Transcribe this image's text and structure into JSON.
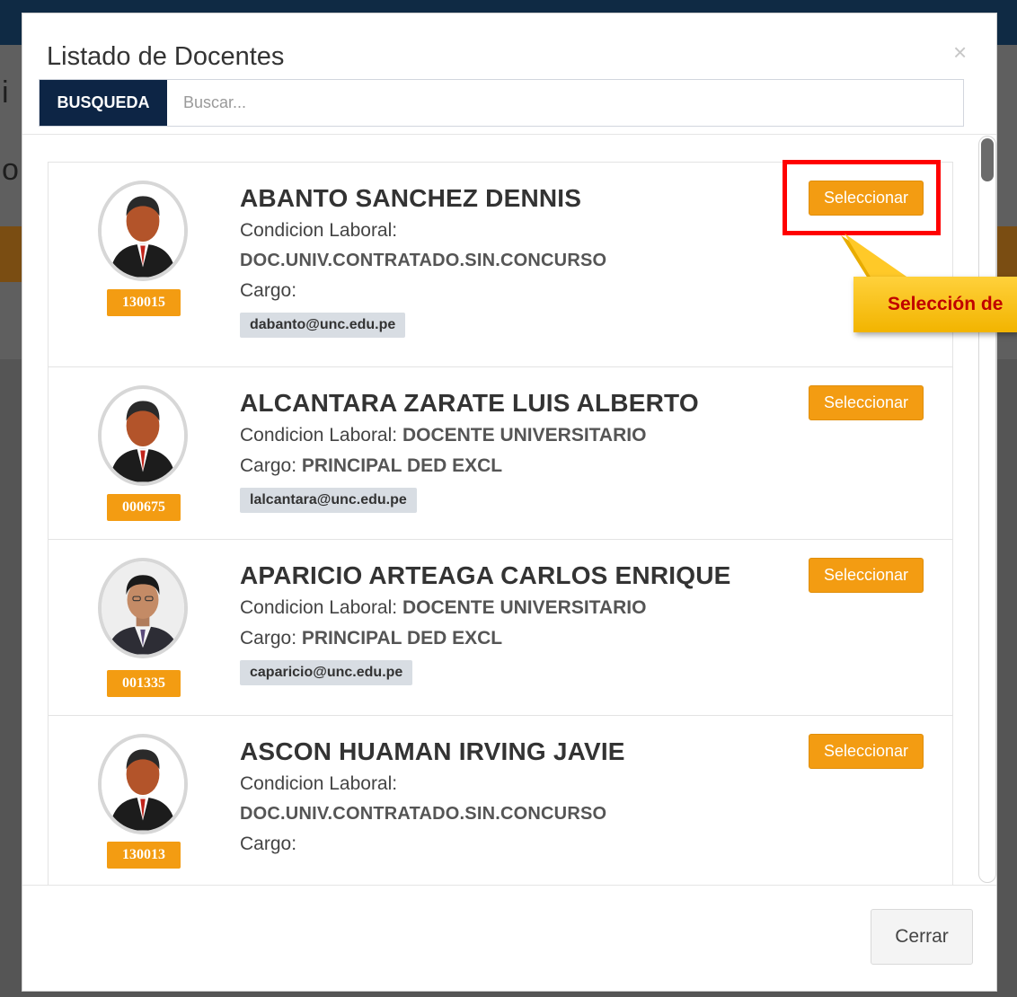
{
  "modal": {
    "title": "Listado de Docentes",
    "close_symbol": "×",
    "search": {
      "addon_label": "BUSQUEDA",
      "placeholder": "Buscar..."
    },
    "footer": {
      "close_label": "Cerrar"
    }
  },
  "labels": {
    "condicion": "Condicion Laboral:",
    "cargo": "Cargo:",
    "select": "Seleccionar"
  },
  "teachers": [
    {
      "name": "ABANTO SANCHEZ DENNIS",
      "code": "130015",
      "condicion": "DOC.UNIV.CONTRATADO.SIN.CONCURSO",
      "cargo": "",
      "email": "dabanto@unc.edu.pe",
      "avatar": "default-user-icon"
    },
    {
      "name": "ALCANTARA ZARATE LUIS ALBERTO",
      "code": "000675",
      "condicion": "DOCENTE UNIVERSITARIO",
      "cargo": "PRINCIPAL DED EXCL",
      "email": "lalcantara@unc.edu.pe",
      "avatar": "default-user-icon"
    },
    {
      "name": "APARICIO ARTEAGA CARLOS ENRIQUE",
      "code": "001335",
      "condicion": "DOCENTE UNIVERSITARIO",
      "cargo": "PRINCIPAL DED EXCL",
      "email": "caparicio@unc.edu.pe",
      "avatar": "photo"
    },
    {
      "name": "ASCON HUAMAN IRVING JAVIE",
      "code": "130013",
      "condicion": "DOC.UNIV.CONTRATADO.SIN.CONCURSO",
      "cargo": "",
      "email": "",
      "avatar": "default-user-icon"
    }
  ],
  "annotation": {
    "callout_text": "Selección de"
  },
  "colors": {
    "primary_dark": "#0d2545",
    "accent_orange": "#f39c12",
    "highlight_red": "#ff0000",
    "callout_yellow": "#f2b400",
    "callout_text": "#c00000"
  }
}
